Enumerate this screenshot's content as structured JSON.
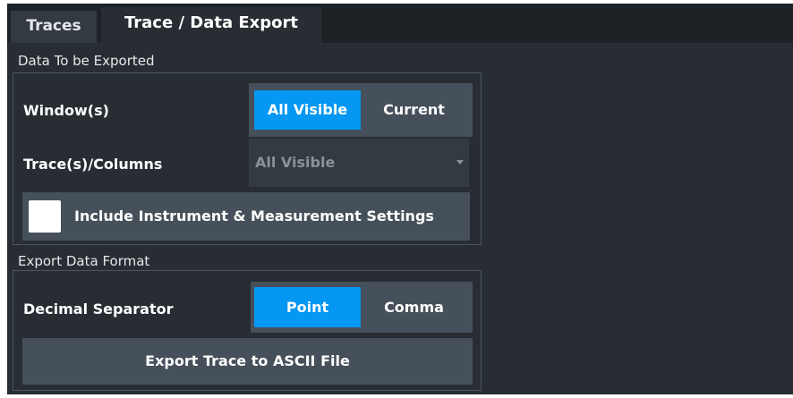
{
  "tabs": {
    "traces": "Traces",
    "export": "Trace / Data Export"
  },
  "data_group": {
    "title": "Data To be Exported",
    "windows_label": "Window(s)",
    "windows_options": [
      "All Visible",
      "Current"
    ],
    "windows_selected": "All Visible",
    "traces_label": "Trace(s)/Columns",
    "traces_value": "All Visible",
    "include_settings_label": "Include Instrument & Measurement Settings",
    "include_settings_checked": false
  },
  "format_group": {
    "title": "Export Data Format",
    "decimal_label": "Decimal Separator",
    "decimal_options": [
      "Point",
      "Comma"
    ],
    "decimal_selected": "Point",
    "export_button": "Export Trace to ASCII File"
  },
  "colors": {
    "active": "#0597f2",
    "button": "#46505a",
    "panel": "#272d33"
  }
}
